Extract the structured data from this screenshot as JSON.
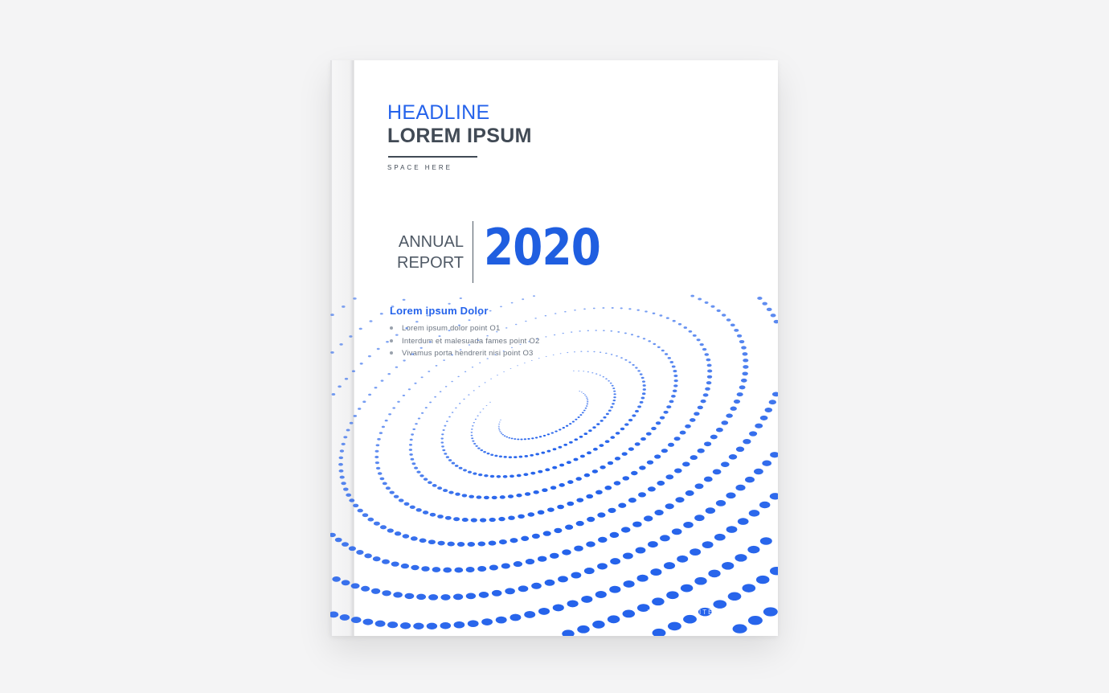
{
  "cover": {
    "headline": "HEADLINE",
    "title": "LOREM IPSUM",
    "tagline": "SPACE HERE",
    "annual": "ANNUAL",
    "report": "REPORT",
    "year": "2020",
    "subheading": "Lorem ipsum Dolor",
    "points": [
      "Lorem ipsum dolor point O1",
      "Interdum et malesuada fames point O2",
      "Vivamus porta hendrerit nisi point O3"
    ],
    "watermark": "WWW.WEBSITE.COM"
  },
  "colors": {
    "accent": "#2563eb",
    "text_dark": "#414a55",
    "background": "#f4f4f5"
  }
}
